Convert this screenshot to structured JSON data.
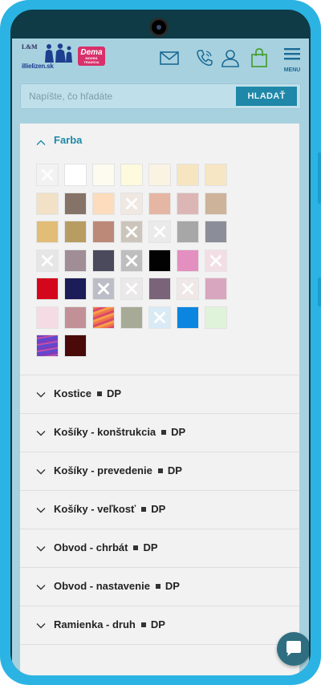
{
  "brand": {
    "lm": "L&M",
    "site": "illielizen.sk",
    "dema": "Dema",
    "dema_sub": "MODRÁ TRADÍCIA"
  },
  "header": {
    "menu_label": "MENU",
    "icons": [
      "mail-icon",
      "phone-icon",
      "user-icon",
      "shopping-bag-icon",
      "hamburger-menu-icon"
    ]
  },
  "search": {
    "placeholder": "Napíšte, čo hľadáte",
    "button": "HLADAŤ"
  },
  "filters": {
    "farba": {
      "label": "Farba",
      "expanded": true,
      "swatches": [
        {
          "color": "#f2f2f2",
          "disabled": true
        },
        {
          "color": "#ffffff",
          "disabled": false
        },
        {
          "color": "#fdfbef",
          "disabled": false
        },
        {
          "color": "#fdfadd",
          "disabled": false
        },
        {
          "color": "#faf3e4",
          "disabled": false
        },
        {
          "color": "#f6e5c0",
          "disabled": false
        },
        {
          "color": "#f7e6c3",
          "disabled": false
        },
        {
          "color": "#f2e1c6",
          "disabled": false
        },
        {
          "color": "#857367",
          "disabled": false
        },
        {
          "color": "#fcdcbc",
          "disabled": false
        },
        {
          "color": "#efe6df",
          "disabled": true
        },
        {
          "color": "#e4b6a3",
          "disabled": false
        },
        {
          "color": "#dcb6b5",
          "disabled": false
        },
        {
          "color": "#cdb39a",
          "disabled": false
        },
        {
          "color": "#e2bd77",
          "disabled": false
        },
        {
          "color": "#b79d62",
          "disabled": false
        },
        {
          "color": "#bc8979",
          "disabled": false
        },
        {
          "color": "#c6beb3",
          "disabled": true
        },
        {
          "color": "#e9e9e9",
          "disabled": true
        },
        {
          "color": "#a7a7a7",
          "disabled": false
        },
        {
          "color": "#8b8d98",
          "disabled": false
        },
        {
          "color": "#e4e4e4",
          "disabled": true
        },
        {
          "color": "#a08d95",
          "disabled": false
        },
        {
          "color": "#4a4a5c",
          "disabled": false
        },
        {
          "color": "#b5b5b5",
          "disabled": true
        },
        {
          "color": "#020202",
          "disabled": false
        },
        {
          "color": "#e38fc0",
          "disabled": false
        },
        {
          "color": "#f4dbe4",
          "disabled": true
        },
        {
          "color": "#d4061c",
          "disabled": false
        },
        {
          "color": "#1c1c58",
          "disabled": false
        },
        {
          "color": "#b4b4c0",
          "disabled": true
        },
        {
          "color": "#e9e7e7",
          "disabled": true
        },
        {
          "color": "#7a6479",
          "disabled": false
        },
        {
          "color": "#efe7e4",
          "disabled": true
        },
        {
          "color": "#d8a6be",
          "disabled": false
        },
        {
          "color": "#f5dce4",
          "disabled": false
        },
        {
          "color": "#c29197",
          "disabled": false
        },
        {
          "color": "#e86a4a",
          "disabled": false,
          "pattern": "stripes-warm"
        },
        {
          "color": "#a7aa96",
          "disabled": false
        },
        {
          "color": "#d4e9f6",
          "disabled": true
        },
        {
          "color": "#0a85e0",
          "disabled": false
        },
        {
          "color": "#dff3da",
          "disabled": false
        },
        {
          "color": "#8a4cc0",
          "disabled": false,
          "pattern": "stripes-purple"
        },
        {
          "color": "#4a0a0a",
          "disabled": false
        }
      ]
    },
    "collapsed": [
      {
        "label": "Kostice",
        "tag": "DP"
      },
      {
        "label": "Košíky - konštrukcia",
        "tag": "DP"
      },
      {
        "label": "Košíky - prevedenie",
        "tag": "DP"
      },
      {
        "label": "Košíky - veľkosť",
        "tag": "DP"
      },
      {
        "label": "Obvod - chrbát",
        "tag": "DP"
      },
      {
        "label": "Obvod - nastavenie",
        "tag": "DP"
      },
      {
        "label": "Ramienka - druh",
        "tag": "DP"
      }
    ]
  },
  "chat": {
    "icon": "chat-bubble-icon"
  },
  "android_nav": {
    "icons": [
      "recent-apps-icon",
      "home-icon",
      "back-icon"
    ]
  }
}
